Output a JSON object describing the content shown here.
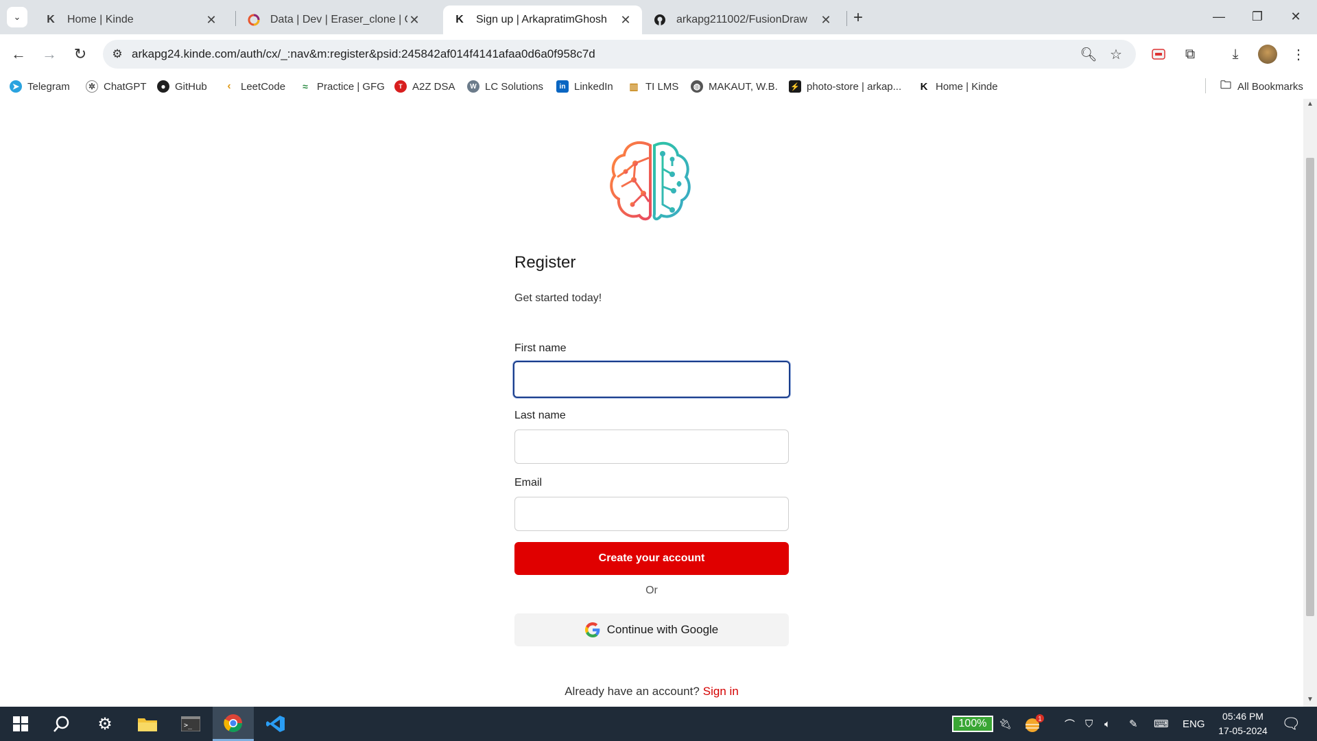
{
  "browser": {
    "tabs": [
      {
        "title": "Home | Kinde",
        "favicon": "K"
      },
      {
        "title": "Data | Dev | Eraser_clone | Conv",
        "favicon": "convex-icon"
      },
      {
        "title": "Sign up | ArkapratimGhosh",
        "favicon": "K"
      },
      {
        "title": "arkapg211002/FusionDraw",
        "favicon": "github-icon"
      }
    ],
    "url": "arkapg24.kinde.com/auth/cx/_:nav&m:register&psid:245842af014f4141afaa0d6a0f958c7d",
    "bookmarks": [
      {
        "label": "Telegram",
        "color": "#2aa3df",
        "glyph": "➤"
      },
      {
        "label": "ChatGPT",
        "color": "#555555",
        "glyph": "✲"
      },
      {
        "label": "GitHub",
        "color": "#1f1f1f",
        "glyph": "●"
      },
      {
        "label": "LeetCode",
        "color": "#f0a020",
        "glyph": "‹"
      },
      {
        "label": "Practice | GFG",
        "color": "#2f8d46",
        "glyph": "≈"
      },
      {
        "label": "A2Z DSA",
        "color": "#d81e1e",
        "glyph": "T"
      },
      {
        "label": "LC Solutions",
        "color": "#6b7b8a",
        "glyph": "W"
      },
      {
        "label": "LinkedIn",
        "color": "#0a66c2",
        "glyph": "in"
      },
      {
        "label": "TI LMS",
        "color": "#c88a1c",
        "glyph": "▥"
      },
      {
        "label": "MAKAUT, W.B.",
        "color": "#555555",
        "glyph": "◍"
      },
      {
        "label": "photo-store | arkap...",
        "color": "#1a1a1a",
        "glyph": "⚡"
      },
      {
        "label": "Home | Kinde",
        "color": "#ffffff",
        "glyph": "K"
      }
    ],
    "all_bookmarks": "All Bookmarks"
  },
  "form": {
    "heading": "Register",
    "subtitle": "Get started today!",
    "first_name_label": "First name",
    "first_name_value": "",
    "last_name_label": "Last name",
    "last_name_value": "",
    "email_label": "Email",
    "email_value": "",
    "submit_label": "Create your account",
    "or_label": "Or",
    "google_label": "Continue with Google",
    "signin_prompt": "Already have an account?",
    "signin_link": "Sign in"
  },
  "taskbar": {
    "battery": "100%",
    "language": "ENG",
    "time": "05:46 PM",
    "date": "17-05-2024",
    "notification_count": "1"
  },
  "colors": {
    "primary": "#e00000",
    "focus": "#1a3e8c",
    "taskbar": "#1f2b38"
  }
}
